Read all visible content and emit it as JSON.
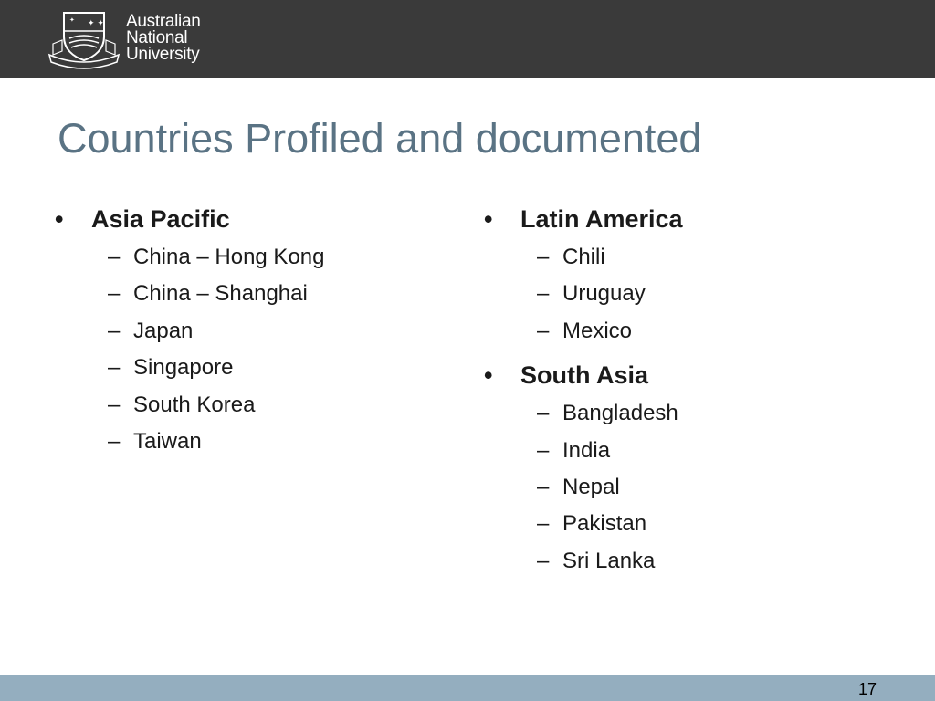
{
  "header": {
    "logo_lines": [
      "Australian",
      "National",
      "University"
    ],
    "bg_color": "#3a3a3a"
  },
  "slide": {
    "title": "Countries Profiled and documented",
    "title_color": "#5a7384",
    "bullet_symbol": "•",
    "dash_symbol": "–",
    "left_column": [
      {
        "heading": "Asia Pacific",
        "items": [
          "China – Hong Kong",
          "China – Shanghai",
          "Japan",
          "Singapore",
          "South Korea",
          "Taiwan"
        ]
      }
    ],
    "right_column": [
      {
        "heading": "Latin America",
        "items": [
          "Chili",
          "Uruguay",
          "Mexico"
        ]
      },
      {
        "heading": "South Asia",
        "items": [
          "Bangladesh",
          "India",
          "Nepal",
          "Pakistan",
          "Sri Lanka"
        ]
      }
    ]
  },
  "footer": {
    "page_number": "17",
    "bg_color": "#94aebf"
  }
}
